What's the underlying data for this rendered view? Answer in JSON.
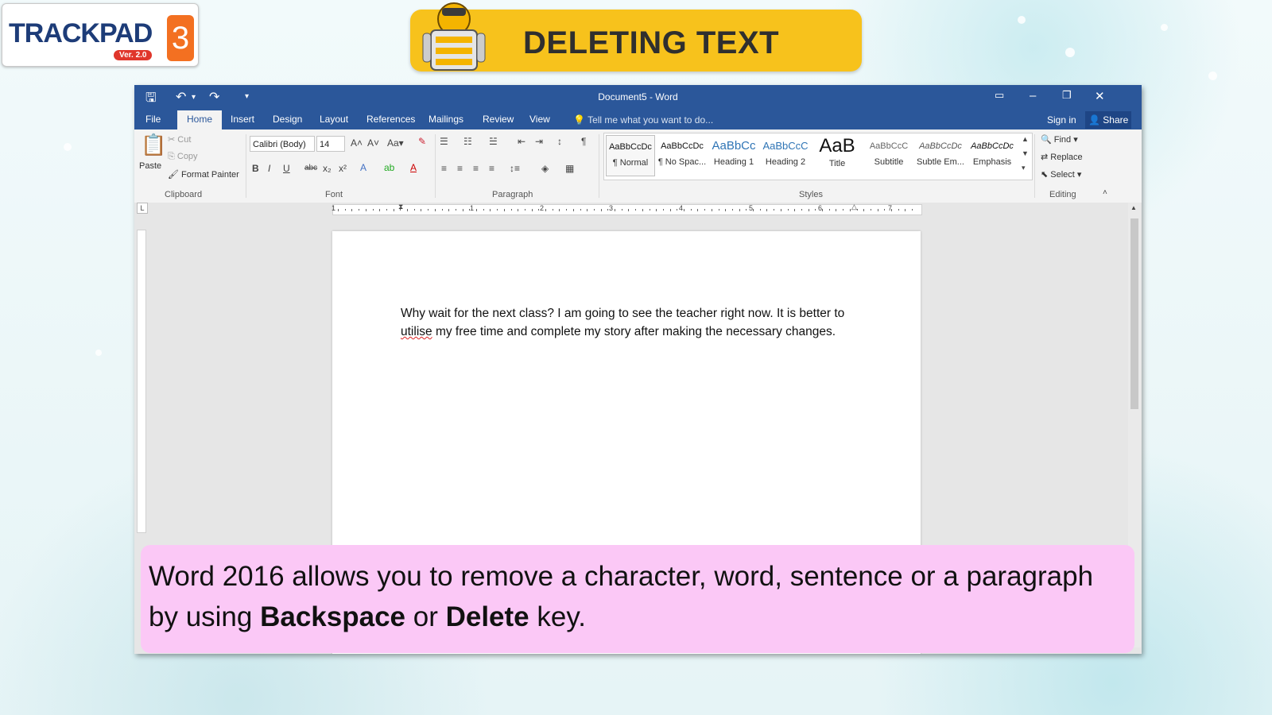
{
  "brand": {
    "name": "TRACKPAD",
    "number": "3",
    "version": "Ver. 2.0"
  },
  "banner": {
    "title": "DELETING TEXT"
  },
  "word": {
    "window_title": "Document5 - Word",
    "tabs": [
      "File",
      "Home",
      "Insert",
      "Design",
      "Layout",
      "References",
      "Mailings",
      "Review",
      "View"
    ],
    "tell_me": "Tell me what you want to do...",
    "sign_in": "Sign in",
    "share": "Share",
    "clipboard": {
      "paste": "Paste",
      "cut": "Cut",
      "copy": "Copy",
      "format_painter": "Format Painter",
      "label": "Clipboard"
    },
    "font": {
      "name": "Calibri (Body)",
      "size": "14",
      "label": "Font"
    },
    "paragraph": {
      "label": "Paragraph"
    },
    "styles": {
      "label": "Styles",
      "items": [
        {
          "preview": "AaBbCcDc",
          "name": "¶ Normal"
        },
        {
          "preview": "AaBbCcDc",
          "name": "¶ No Spac..."
        },
        {
          "preview": "AaBbCc",
          "name": "Heading 1"
        },
        {
          "preview": "AaBbCcC",
          "name": "Heading 2"
        },
        {
          "preview": "AaB",
          "name": "Title"
        },
        {
          "preview": "AaBbCcC",
          "name": "Subtitle"
        },
        {
          "preview": "AaBbCcDc",
          "name": "Subtle Em..."
        },
        {
          "preview": "AaBbCcDc",
          "name": "Emphasis"
        }
      ]
    },
    "editing": {
      "find": "Find",
      "replace": "Replace",
      "select": "Select",
      "label": "Editing"
    },
    "document": {
      "line1": "Why wait for the next class? I am going to see the teacher right now. It is better to",
      "line2_misspelled": "utilise",
      "line2_rest": " my free time and complete my story after making the necessary changes."
    },
    "ruler_numbers": [
      "1",
      "1",
      "2",
      "3",
      "4",
      "5",
      "6",
      "7"
    ]
  },
  "caption": {
    "part1": "Word 2016 allows you to remove a character, word, sentence or a paragraph by using ",
    "bold1": "Backspace",
    "mid": " or ",
    "bold2": "Delete",
    "end": " key."
  },
  "colors": {
    "word_blue": "#2b579a",
    "banner_yellow": "#f7c21c",
    "caption_pink": "#fbc8f6",
    "logo_orange": "#f37021"
  }
}
